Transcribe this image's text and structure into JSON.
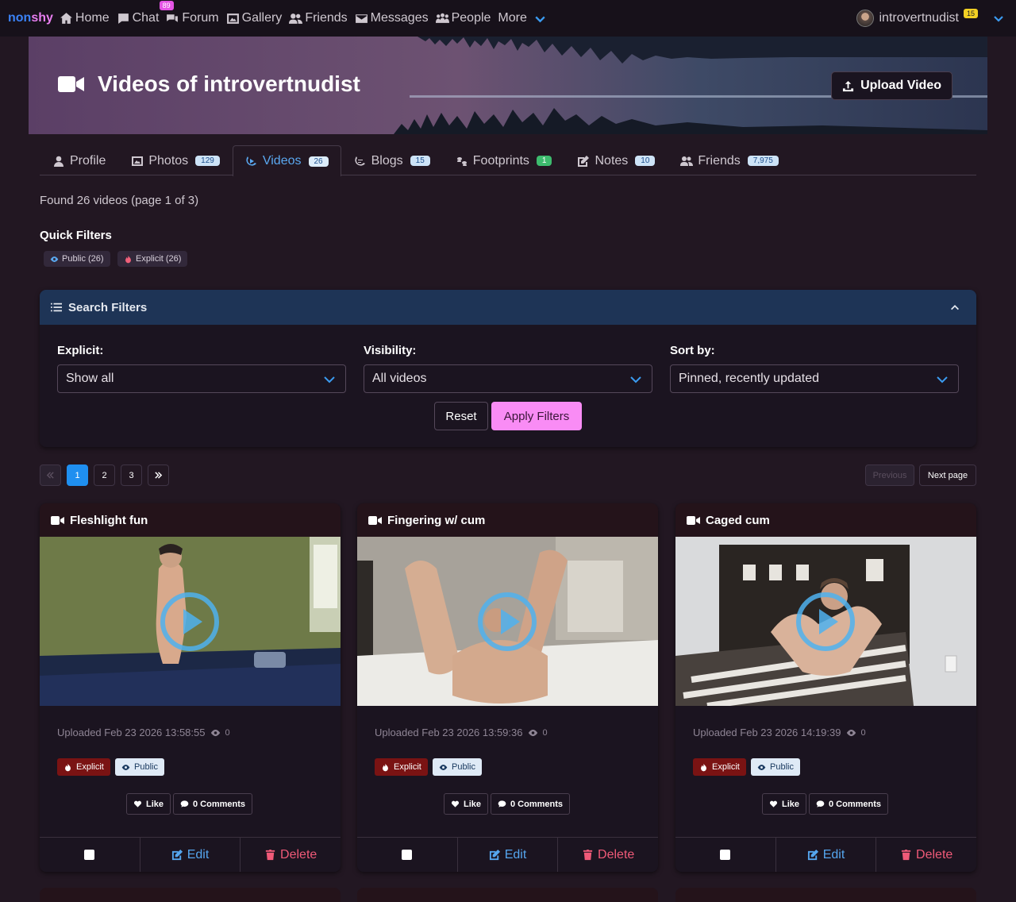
{
  "brand": {
    "part1": "non",
    "part2": "shy"
  },
  "nav": {
    "items": [
      {
        "label": "Home",
        "icon": "home-icon"
      },
      {
        "label": "Chat",
        "icon": "chat-icon",
        "badge": "89"
      },
      {
        "label": "Forum",
        "icon": "forum-icon"
      },
      {
        "label": "Gallery",
        "icon": "gallery-icon"
      },
      {
        "label": "Friends",
        "icon": "friends-icon"
      },
      {
        "label": "Messages",
        "icon": "envelope-icon"
      },
      {
        "label": "People",
        "icon": "people-icon"
      },
      {
        "label": "More",
        "icon": "chevron-down-icon"
      }
    ],
    "user": {
      "name": "introvertnudist",
      "badge": "15"
    }
  },
  "banner": {
    "title": "Videos of introvertnudist",
    "upload_label": "Upload Video"
  },
  "tabs": [
    {
      "label": "Profile",
      "count": ""
    },
    {
      "label": "Photos",
      "count": "129"
    },
    {
      "label": "Videos",
      "count": "26",
      "active": true
    },
    {
      "label": "Blogs",
      "count": "15"
    },
    {
      "label": "Footprints",
      "count": "1"
    },
    {
      "label": "Notes",
      "count": "10"
    },
    {
      "label": "Friends",
      "count": "7,975"
    }
  ],
  "found_text": "Found 26 videos (page 1 of 3)",
  "quick_filters": {
    "title": "Quick Filters",
    "public": "Public (26)",
    "explicit": "Explicit (26)"
  },
  "search_filters": {
    "title": "Search Filters",
    "explicit_label": "Explicit:",
    "explicit_value": "Show all",
    "visibility_label": "Visibility:",
    "visibility_value": "All videos",
    "sort_label": "Sort by:",
    "sort_value": "Pinned, recently updated",
    "reset_label": "Reset",
    "apply_label": "Apply Filters"
  },
  "pagination": {
    "pages": [
      "1",
      "2",
      "3"
    ],
    "previous": "Previous",
    "next": "Next page"
  },
  "cards": [
    {
      "title": "Fleshlight fun",
      "uploaded": "Uploaded Feb 23 2026 13:58:55",
      "views": "0",
      "explicit": "Explicit",
      "public": "Public",
      "like": "Like",
      "comments": "0 Comments",
      "edit": "Edit",
      "delete": "Delete"
    },
    {
      "title": "Fingering w/ cum",
      "uploaded": "Uploaded Feb 23 2026 13:59:36",
      "views": "0",
      "explicit": "Explicit",
      "public": "Public",
      "like": "Like",
      "comments": "0 Comments",
      "edit": "Edit",
      "delete": "Delete"
    },
    {
      "title": "Caged cum",
      "uploaded": "Uploaded Feb 23 2026 14:19:39",
      "views": "0",
      "explicit": "Explicit",
      "public": "Public",
      "like": "Like",
      "comments": "0 Comments",
      "edit": "Edit",
      "delete": "Delete"
    }
  ],
  "colors": {
    "accent_pink": "#f98cf5",
    "accent_blue": "#1f8ff0",
    "explicit_red": "#7a1313",
    "page_bg": "#221722"
  }
}
